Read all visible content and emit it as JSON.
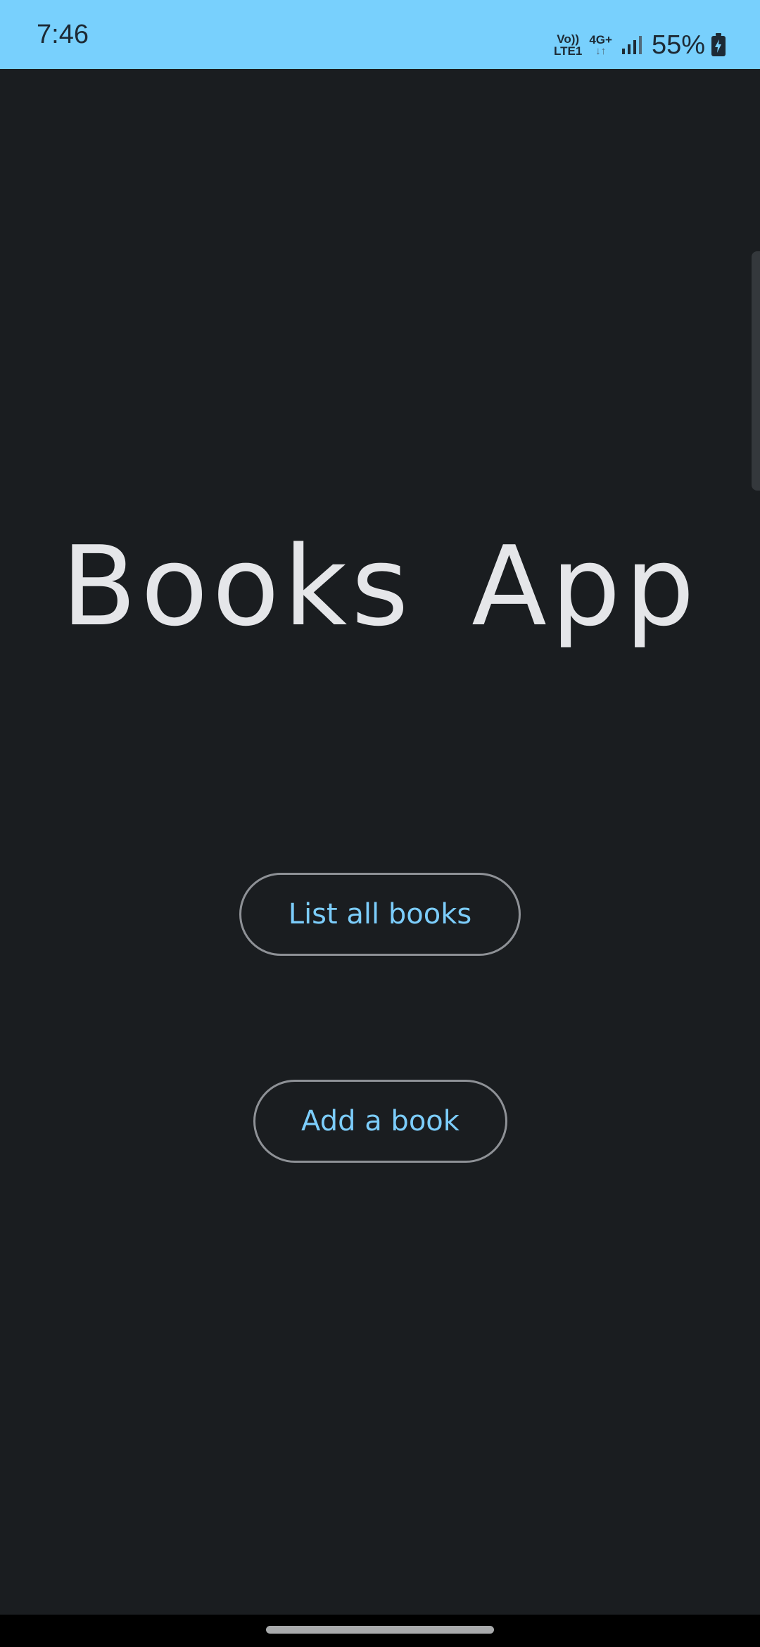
{
  "status_bar": {
    "time": "7:46",
    "volte_top": "Vo))",
    "volte_bottom": "LTE1",
    "network": "4G+",
    "network_arrows": "↓↑",
    "battery": "55%"
  },
  "main": {
    "title": "Books App",
    "list_button": "List all books",
    "add_button": "Add a book"
  },
  "colors": {
    "status_bar_bg": "#78d0fd",
    "background": "#1a1d20",
    "accent": "#7ccdfb",
    "title_text": "#e5e6e9",
    "button_border": "#8e9196"
  },
  "icons": [
    "signal-icon",
    "battery-charging-icon"
  ]
}
